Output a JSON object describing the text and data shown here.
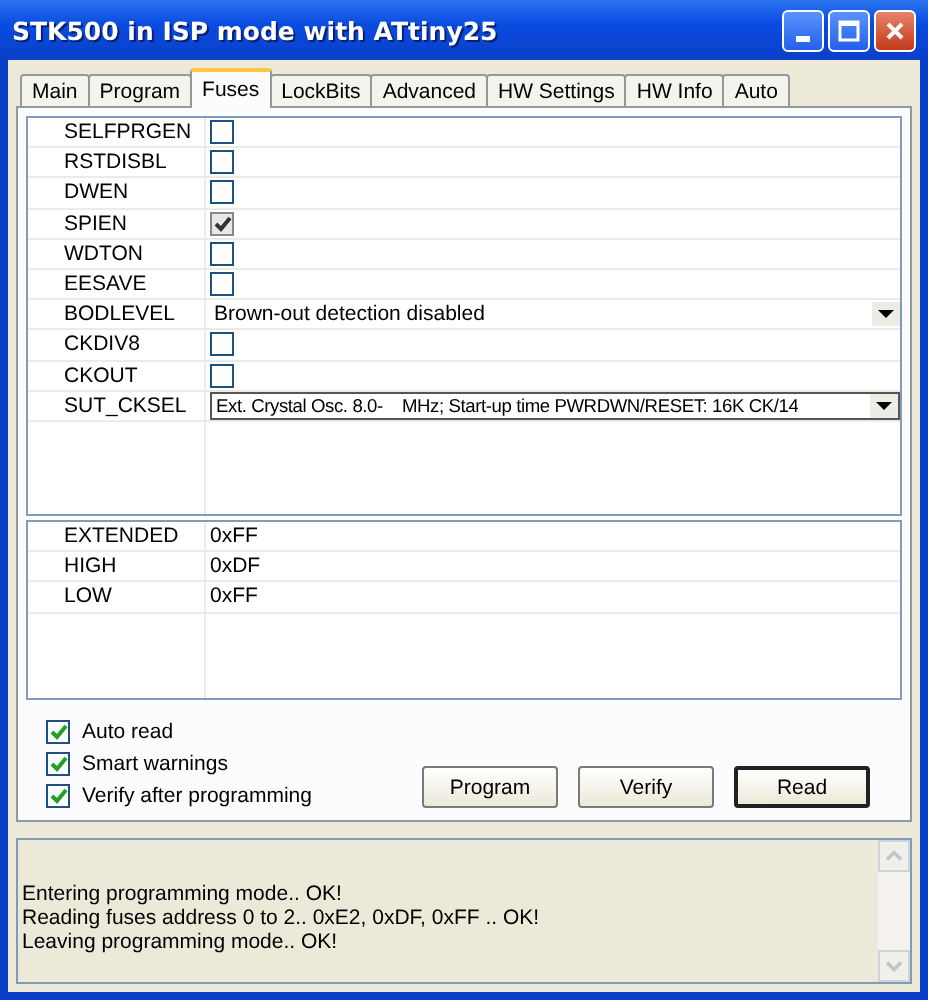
{
  "window": {
    "title": "STK500 in ISP mode with ATtiny25"
  },
  "tabs": [
    {
      "label": "Main",
      "selected": false
    },
    {
      "label": "Program",
      "selected": false
    },
    {
      "label": "Fuses",
      "selected": true
    },
    {
      "label": "LockBits",
      "selected": false
    },
    {
      "label": "Advanced",
      "selected": false
    },
    {
      "label": "HW Settings",
      "selected": false
    },
    {
      "label": "HW Info",
      "selected": false
    },
    {
      "label": "Auto",
      "selected": false
    }
  ],
  "fuses": [
    {
      "name": "SELFPRGEN",
      "kind": "checkbox",
      "checked": false
    },
    {
      "name": "RSTDISBL",
      "kind": "checkbox",
      "checked": false
    },
    {
      "name": "DWEN",
      "kind": "checkbox",
      "checked": false
    },
    {
      "name": "SPIEN",
      "kind": "checkbox",
      "checked": true
    },
    {
      "name": "WDTON",
      "kind": "checkbox",
      "checked": false
    },
    {
      "name": "EESAVE",
      "kind": "checkbox",
      "checked": false
    },
    {
      "name": "BODLEVEL",
      "kind": "select",
      "value": "Brown-out detection disabled"
    },
    {
      "name": "CKDIV8",
      "kind": "checkbox",
      "checked": false
    },
    {
      "name": "CKOUT",
      "kind": "checkbox",
      "checked": false
    },
    {
      "name": "SUT_CKSEL",
      "kind": "select",
      "value": "Ext. Crystal Osc. 8.0-    MHz; Start-up time PWRDWN/RESET: 16K CK/14"
    }
  ],
  "registers": [
    {
      "name": "EXTENDED",
      "value": "0xFF"
    },
    {
      "name": "HIGH",
      "value": "0xDF"
    },
    {
      "name": "LOW",
      "value": "0xFF"
    }
  ],
  "options": [
    {
      "label": "Auto read",
      "checked": true
    },
    {
      "label": "Smart warnings",
      "checked": true
    },
    {
      "label": "Verify after programming",
      "checked": true
    }
  ],
  "buttons": [
    {
      "label": "Program",
      "selected": false
    },
    {
      "label": "Verify",
      "selected": false
    },
    {
      "label": "Read",
      "selected": true
    }
  ],
  "log": [
    "Entering programming mode.. OK!",
    "Reading fuses address 0 to 2.. 0xE2, 0xDF, 0xFF .. OK!",
    "Leaving programming mode.. OK!"
  ]
}
